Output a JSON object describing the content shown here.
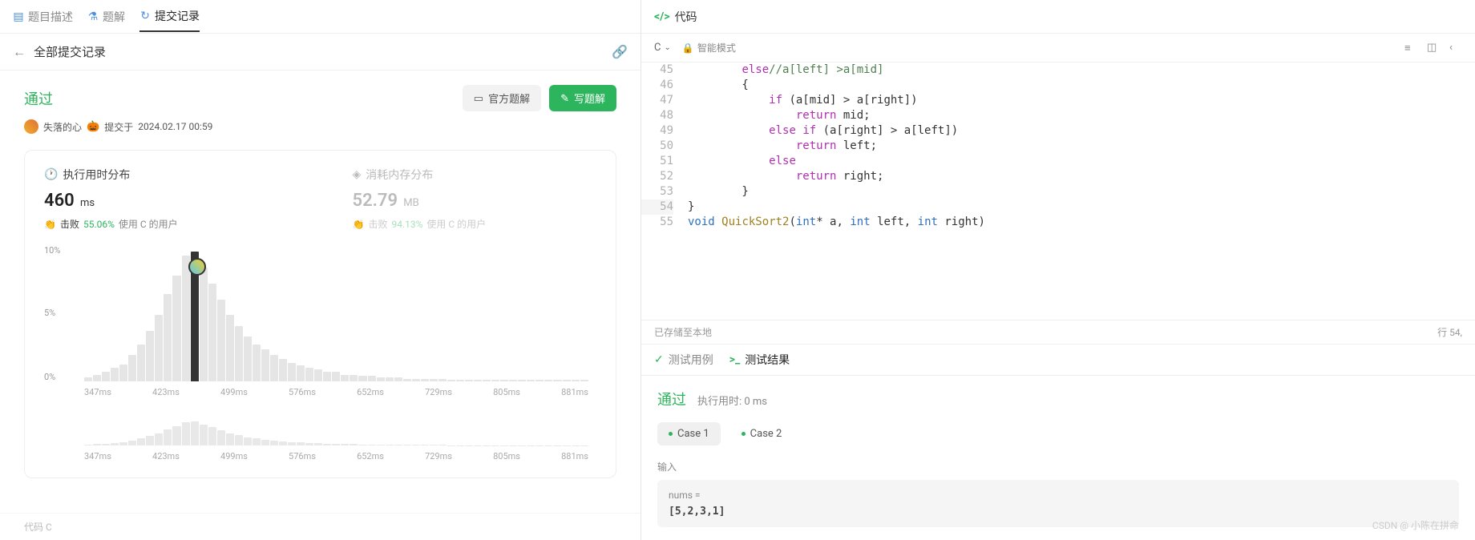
{
  "left": {
    "tabs": {
      "problem": "题目描述",
      "solution": "题解",
      "submissions": "提交记录"
    },
    "header": {
      "title": "全部提交记录"
    },
    "submission": {
      "status": "通过",
      "author": "失落的心",
      "submitted_prefix": "提交于",
      "submitted_at": "2024.02.17 00:59",
      "buttons": {
        "official": "官方题解",
        "write": "写题解"
      }
    },
    "stats": {
      "time": {
        "label": "执行用时分布",
        "value": "460",
        "unit": "ms",
        "beat_label": "击败",
        "beat_pct": "55.06%",
        "beat_suffix": "使用 C 的用户"
      },
      "memory": {
        "label": "消耗内存分布",
        "value": "52.79",
        "unit": "MB",
        "beat_label": "击败",
        "beat_pct": "94.13%",
        "beat_suffix": "使用 C 的用户"
      }
    },
    "footer": "代码  C"
  },
  "right": {
    "code_tab": "代码",
    "toolbar": {
      "language": "C",
      "mode": "智能模式"
    },
    "editor": {
      "status_left": "已存储至本地",
      "status_right": "行 54,"
    },
    "test": {
      "tab_cases": "测试用例",
      "tab_results": "测试结果",
      "status": "通过",
      "time_label": "执行用时: 0 ms",
      "cases": [
        "Case 1",
        "Case 2"
      ],
      "input_label": "输入",
      "input_var": "nums =",
      "input_val": "[5,2,3,1]"
    }
  },
  "watermark": "CSDN @ 小陈在拼命",
  "code_lines": [
    {
      "n": 45,
      "indent": 2,
      "html": "<span class='kw'>else</span><span class='cm'>//a[left] &gt;a[mid]</span>"
    },
    {
      "n": 46,
      "indent": 2,
      "html": "{"
    },
    {
      "n": 47,
      "indent": 3,
      "html": "<span class='kw'>if</span> (a[mid] &gt; a[right])"
    },
    {
      "n": 48,
      "indent": 4,
      "html": "<span class='kw'>return</span> mid;"
    },
    {
      "n": 49,
      "indent": 3,
      "html": "<span class='kw'>else</span> <span class='kw'>if</span> (a[right] &gt; a[left])"
    },
    {
      "n": 50,
      "indent": 4,
      "html": "<span class='kw'>return</span> left;"
    },
    {
      "n": 51,
      "indent": 3,
      "html": "<span class='kw'>else</span>"
    },
    {
      "n": 52,
      "indent": 4,
      "html": "<span class='kw'>return</span> right;"
    },
    {
      "n": 53,
      "indent": 2,
      "html": "}"
    },
    {
      "n": 54,
      "indent": 0,
      "html": "}",
      "sel": true
    },
    {
      "n": 55,
      "indent": 0,
      "html": "<span class='ty'>void</span> <span class='fn'>QuickSort2</span>(<span class='ty'>int</span>* a, <span class='ty'>int</span> left, <span class='ty'>int</span> right)"
    }
  ],
  "chart_data": {
    "type": "bar",
    "title": "执行用时分布",
    "xlabel": "ms",
    "ylabel": "%",
    "ylim": [
      0,
      10
    ],
    "x_ticks": [
      "347ms",
      "423ms",
      "499ms",
      "576ms",
      "652ms",
      "729ms",
      "805ms",
      "881ms"
    ],
    "categories_ms": [
      347,
      356,
      366,
      375,
      385,
      394,
      404,
      413,
      423,
      432,
      442,
      451,
      461,
      470,
      480,
      489,
      499,
      508,
      518,
      527,
      537,
      546,
      556,
      565,
      576,
      585,
      595,
      604,
      614,
      623,
      633,
      642,
      652,
      661,
      671,
      680,
      690,
      699,
      709,
      718,
      729,
      738,
      748,
      757,
      767,
      776,
      786,
      795,
      805,
      814,
      824,
      833,
      843,
      852,
      862,
      871,
      881
    ],
    "values_pct": [
      0.3,
      0.5,
      0.7,
      1.0,
      1.3,
      2.0,
      2.8,
      3.8,
      5.0,
      6.6,
      8.0,
      9.5,
      9.8,
      8.6,
      7.4,
      6.2,
      5.0,
      4.2,
      3.4,
      2.8,
      2.4,
      2.0,
      1.7,
      1.4,
      1.2,
      1.0,
      0.9,
      0.7,
      0.7,
      0.5,
      0.5,
      0.4,
      0.4,
      0.3,
      0.3,
      0.3,
      0.2,
      0.2,
      0.2,
      0.2,
      0.2,
      0.1,
      0.1,
      0.1,
      0.1,
      0.1,
      0.1,
      0.1,
      0.1,
      0.1,
      0.1,
      0.1,
      0.1,
      0.1,
      0.1,
      0.1,
      0.1
    ],
    "highlight_ms": 460,
    "marker_value": 460,
    "y_ticks": [
      "10%",
      "5%",
      "0%"
    ]
  }
}
